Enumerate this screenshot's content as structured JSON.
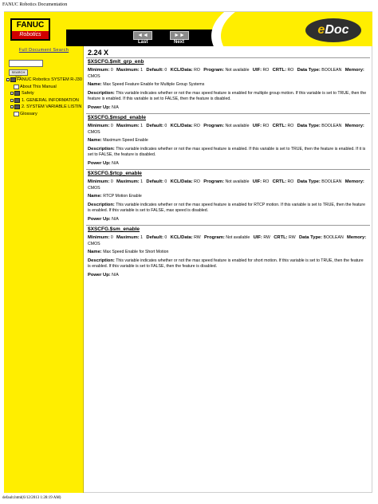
{
  "print": {
    "title": "FANUC Robotics Documentation",
    "footer": "default.html(6/12/2013 1:28:19 AM)"
  },
  "header": {
    "logo_top": "FANUC",
    "logo_bottom": "Robotics",
    "nav_last_btn": "◄◄",
    "nav_next_btn": "►►",
    "nav_last_label": "Last",
    "nav_next_label": "Next",
    "edoc_e": "e",
    "edoc_rest": "Doc"
  },
  "sidebar": {
    "search_link": "Full Document Search",
    "search_value": "",
    "search_button": "SEARCH TOC",
    "tree": [
      {
        "label": "FANUC Robotics SYSTEM R-J30",
        "icon": "book-icon",
        "level": 0
      },
      {
        "label": "About This Manual",
        "icon": "page-icon",
        "level": 1
      },
      {
        "label": "Safety",
        "icon": "book-icon",
        "level": 1
      },
      {
        "label": "1. GENERAL INFORMATION",
        "icon": "book-icon",
        "level": 1
      },
      {
        "label": "2. SYSTEM VARIABLE LISTIN",
        "icon": "book-icon",
        "level": 1
      },
      {
        "label": "Glossary",
        "icon": "page-icon",
        "level": 1
      }
    ]
  },
  "content": {
    "section_title": "2.24 X",
    "labels": {
      "minimum": "Minimum:",
      "maximum": "Maximum:",
      "default": "Default:",
      "kcl": "KCL/Data:",
      "program": "Program:",
      "uif": "UIF:",
      "crtl": "CRTL:",
      "data_type": "Data Type:",
      "memory": "Memory:",
      "name": "Name:",
      "description": "Description:",
      "power_up": "Power Up:"
    },
    "entries": [
      {
        "name": "$XSCFG.$mlt_grp_enb",
        "minimum": "0",
        "maximum": "1",
        "default": "0",
        "kcl": "RO",
        "program": "Not available",
        "uif": "RO",
        "crtl": "RO",
        "data_type": "BOOLEAN",
        "memory": "CMOS",
        "title": "Max Speed Feature Enable for Multiple Group Systems",
        "description": "This variable indicates whether or not the max speed feature is enabled for multiple group motion. If this variable is set to TRUE, then the feature is enabled. If this variable is set to FALSE, then the feature is disabled.",
        "power_up": "N/A"
      },
      {
        "name": "$XSCFG.$mspd_enable",
        "minimum": "0",
        "maximum": "1",
        "default": "0",
        "kcl": "RO",
        "program": "Not available",
        "uif": "RO",
        "crtl": "RO",
        "data_type": "BOOLEAN",
        "memory": "CMOS",
        "title": "Maximum Speed Enable",
        "description": "This variable indicates whether or not the max speed feature is enabled. If this variable is set to TRUE, then the feature is enabled. If it is set to FALSE, the feature is disabled.",
        "power_up": "N/A"
      },
      {
        "name": "$XSCFG.$rtcp_enable",
        "minimum": "0",
        "maximum": "1",
        "default": "0",
        "kcl": "RO",
        "program": "Not available",
        "uif": "RO",
        "crtl": "RO",
        "data_type": "BOOLEAN",
        "memory": "CMOS",
        "title": "RTCP Motion Enable",
        "description": "This variable indicates whether or not the max speed feature is enabled for RTCP motion. If this variable is set to TRUE, then the feature is enabled. If this variable is set to FALSE, max speed is disabled.",
        "power_up": "N/A"
      },
      {
        "name": "$XSCFG.$sm_enable",
        "minimum": "0",
        "maximum": "1",
        "default": "0",
        "kcl": "RW",
        "program": "Not available",
        "uif": "RW",
        "crtl": "RW",
        "data_type": "BOOLEAN",
        "memory": "CMOS",
        "title": "Max Speed Enable for Short Motion",
        "description": "This variable indicates whether or not the max speed feature is enabled for short motion. If this variable is set to TRUE, then the feature is enabled. If this variable is set to FALSE, then the feature is disabled.",
        "power_up": "N/A"
      }
    ]
  },
  "colors": {
    "banner_yellow": "#ffee00",
    "navbar_black": "#000000",
    "logo_red": "#d00000",
    "link_blue": "#2222aa"
  }
}
